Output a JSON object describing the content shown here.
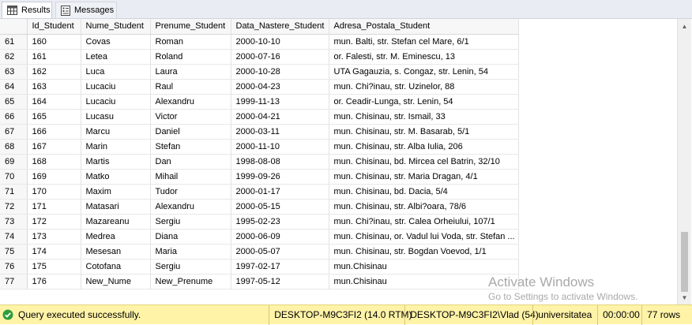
{
  "tabs": {
    "results_label": "Results",
    "messages_label": "Messages"
  },
  "grid": {
    "columns": [
      "Id_Student",
      "Nume_Student",
      "Prenume_Student",
      "Data_Nastere_Student",
      "Adresa_Postala_Student"
    ],
    "rows": [
      {
        "rn": "61",
        "cells": [
          "160",
          "Covas",
          "Roman",
          "2000-10-10",
          "mun. Balti, str. Stefan cel Mare, 6/1"
        ]
      },
      {
        "rn": "62",
        "cells": [
          "161",
          "Letea",
          "Roland",
          "2000-07-16",
          "or. Falesti, str. M. Eminescu, 13"
        ]
      },
      {
        "rn": "63",
        "cells": [
          "162",
          "Luca",
          "Laura",
          "2000-10-28",
          "UTA Gagauzia, s. Congaz, str. Lenin, 54"
        ]
      },
      {
        "rn": "64",
        "cells": [
          "163",
          "Lucaciu",
          "Raul",
          "2000-04-23",
          "mun. Chi?inau, str. Uzinelor, 88"
        ]
      },
      {
        "rn": "65",
        "cells": [
          "164",
          "Lucaciu",
          "Alexandru",
          "1999-11-13",
          "or. Ceadir-Lunga, str. Lenin, 54"
        ]
      },
      {
        "rn": "66",
        "cells": [
          "165",
          "Lucasu",
          "Victor",
          "2000-04-21",
          "mun. Chisinau, str. Ismail, 33"
        ]
      },
      {
        "rn": "67",
        "cells": [
          "166",
          "Marcu",
          "Daniel",
          "2000-03-11",
          "mun. Chisinau, str. M. Basarab, 5/1"
        ]
      },
      {
        "rn": "68",
        "cells": [
          "167",
          "Marin",
          "Stefan",
          "2000-11-10",
          "mun. Chisinau, str. Alba Iulia, 206"
        ]
      },
      {
        "rn": "69",
        "cells": [
          "168",
          "Martis",
          "Dan",
          "1998-08-08",
          "mun. Chisinau, bd. Mircea cel Batrin, 32/10"
        ]
      },
      {
        "rn": "70",
        "cells": [
          "169",
          "Matko",
          "Mihail",
          "1999-09-26",
          "mun. Chisinau, str. Maria Dragan, 4/1"
        ]
      },
      {
        "rn": "71",
        "cells": [
          "170",
          "Maxim",
          "Tudor",
          "2000-01-17",
          "mun. Chisinau, bd. Dacia, 5/4"
        ]
      },
      {
        "rn": "72",
        "cells": [
          "171",
          "Matasari",
          "Alexandru",
          "2000-05-15",
          "mun. Chisinau, str. Albi?oara, 78/6"
        ]
      },
      {
        "rn": "73",
        "cells": [
          "172",
          "Mazareanu",
          "Sergiu",
          "1995-02-23",
          "mun. Chi?inau, str. Calea Orheiului, 107/1"
        ]
      },
      {
        "rn": "74",
        "cells": [
          "173",
          "Medrea",
          "Diana",
          "2000-06-09",
          "mun. Chisinau, or. Vadul lui Voda, str. Stefan ..."
        ]
      },
      {
        "rn": "75",
        "cells": [
          "174",
          "Mesesan",
          "Maria",
          "2000-05-07",
          "mun. Chisinau, str. Bogdan Voevod, 1/1"
        ]
      },
      {
        "rn": "76",
        "cells": [
          "175",
          "Cotofana",
          "Sergiu",
          "1997-02-17",
          "mun.Chisinau"
        ]
      },
      {
        "rn": "77",
        "cells": [
          "176",
          "New_Nume",
          "New_Prenume",
          "1997-05-12",
          "mun.Chisinau"
        ]
      }
    ]
  },
  "watermark": {
    "title": "Activate Windows",
    "subtitle": "Go to Settings to activate Windows."
  },
  "status": {
    "message": "Query executed successfully.",
    "server": "DESKTOP-M9C3FI2 (14.0 RTM)",
    "user": "DESKTOP-M9C3FI2\\Vlad (54)",
    "database": "universitatea",
    "elapsed": "00:00:00",
    "row_count": "77 rows"
  },
  "colors": {
    "status_bg": "#fff3a8",
    "success_icon": "#2e9d3a"
  }
}
